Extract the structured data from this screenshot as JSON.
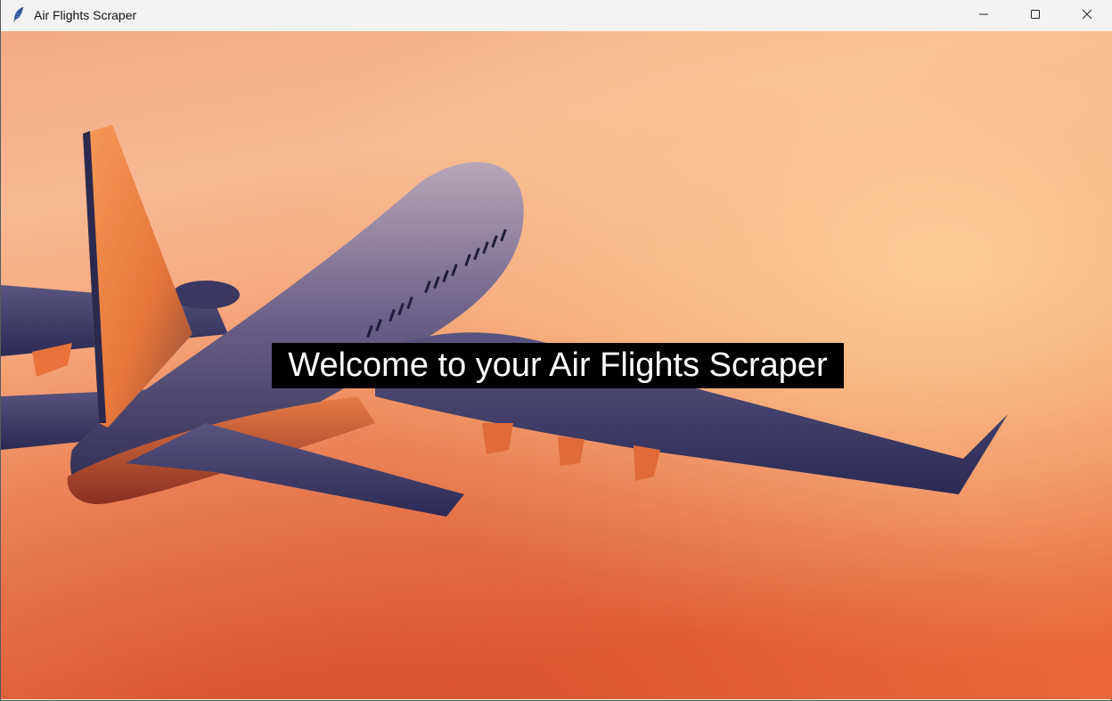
{
  "window": {
    "title": "Air Flights Scraper",
    "app_icon": "feather-icon",
    "controls": {
      "minimize": "minimize-icon",
      "maximize": "maximize-icon",
      "close": "close-icon"
    }
  },
  "main": {
    "background_image": "airplane-sunset-image",
    "welcome_text": "Welcome to your Air Flights Scraper"
  },
  "colors": {
    "label_background": "#000000",
    "label_text": "#ffffff",
    "sky_light": "#f9b98f",
    "sky_dark": "#e8663a"
  }
}
